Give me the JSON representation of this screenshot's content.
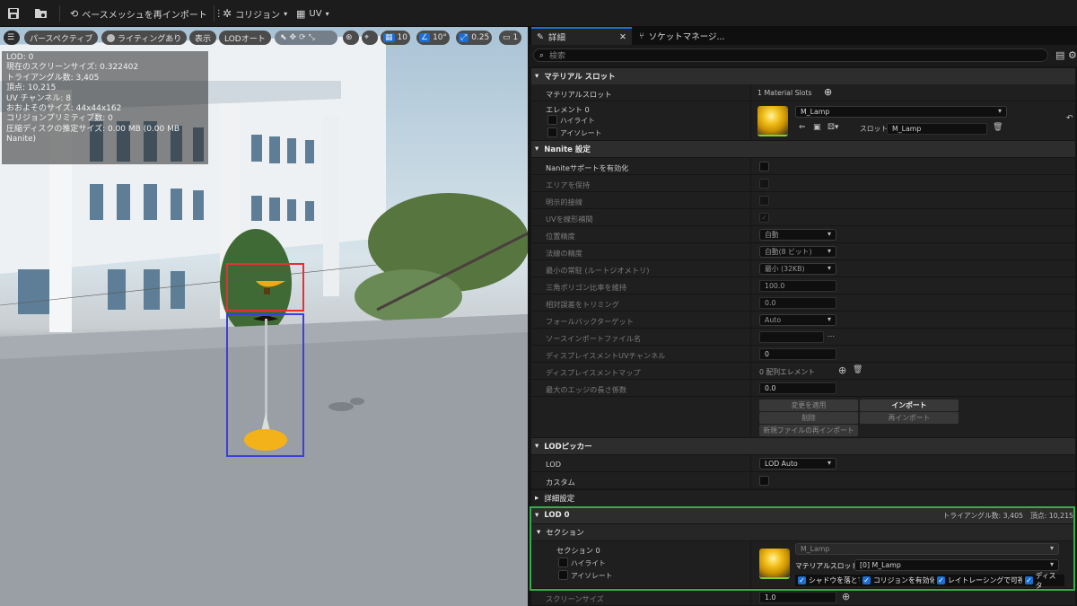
{
  "toolbar": {
    "reimport_base_mesh": "ベースメッシュを再インポート",
    "collision": "コリジョン",
    "uv": "UV"
  },
  "viewport": {
    "perspective": "パースペクティブ",
    "lighting": "ライティングあり",
    "show": "表示",
    "lod_auto": "LODオート",
    "grid_snap": "10",
    "rotation_snap": "10°",
    "scale_snap": "0.25",
    "camera_speed": "1",
    "stats": [
      "LOD: 0",
      "現在のスクリーンサイズ: 0.322402",
      "トライアングル数: 3,405",
      "頂点: 10,215",
      "UV チャンネル: 8",
      "おおよそのサイズ: 44x44x162",
      "コリジョンプリミティブ数: 0",
      "圧縮ディスクの推定サイズ: 0.00 MB (0.00 MB Nanite)"
    ]
  },
  "tabs": {
    "details": "詳細",
    "socket_manager": "ソケットマネージ..."
  },
  "search": {
    "placeholder": "検索"
  },
  "material_slots": {
    "category": "マテリアル スロット",
    "label": "マテリアルスロット",
    "count": "1 Material Slots",
    "element": "エレメント 0",
    "highlight": "ハイライト",
    "isolate": "アイソレート",
    "material": "M_Lamp",
    "slot_label": "スロット",
    "slot_name": "M_Lamp"
  },
  "nanite": {
    "category": "Nanite 設定",
    "enable": "Naniteサポートを有効化",
    "preserve_area": "エリアを保持",
    "explicit_tangents": "明示的接線",
    "lerp_uvs": "UVを線形補間",
    "position_precision": "位置精度",
    "position_precision_value": "自動",
    "normal_precision": "法線の精度",
    "normal_precision_value": "自動(8 ビット)",
    "min_residency": "最小の常駐 (ルートジオメトリ)",
    "min_residency_value": "最小 (32KB)",
    "keep_triangle_percent": "三角ポリゴン比率を維持",
    "keep_triangle_value": "100.0",
    "trim_relative_error": "相対誤差をトリミング",
    "trim_value": "0.0",
    "fallback_target": "フォールバックターゲット",
    "fallback_value": "Auto",
    "source_import_file": "ソースインポートファイル名",
    "displacement_uv": "ディスプレイスメントUVチャンネル",
    "displacement_uv_value": "0",
    "displacement_maps": "ディスプレイスメントマップ",
    "displacement_maps_value": "0 配列エレメント",
    "max_edge_length": "最大のエッジの長さ係数",
    "max_edge_value": "0.0",
    "apply_changes": "変更を適用",
    "import": "インポート",
    "delete": "削除",
    "reimport": "再インポート",
    "reimport_new_file": "新規ファイルの再インポート"
  },
  "lod_picker": {
    "category": "LODピッカー",
    "lod": "LOD",
    "lod_value": "LOD Auto",
    "custom": "カスタム"
  },
  "advanced": {
    "category": "詳細設定"
  },
  "lod0": {
    "category": "LOD 0",
    "triangles": "トライアングル数: 3,405",
    "vertices": "頂点: 10,215",
    "sections": "セクション",
    "section0": "セクション 0",
    "highlight": "ハイライト",
    "isolate": "アイソレート",
    "material_top": "M_Lamp",
    "material_slot_label": "マテリアルスロット",
    "material_slot_value": "[0] M_Lamp",
    "cast_shadow": "シャドウを落とす",
    "enable_collision": "コリジョンを有効化",
    "raytracing_visible": "レイトレーシングで可視化",
    "distance": "ディスタ",
    "screen_size": "スクリーンサイズ",
    "screen_size_value": "1.0"
  }
}
